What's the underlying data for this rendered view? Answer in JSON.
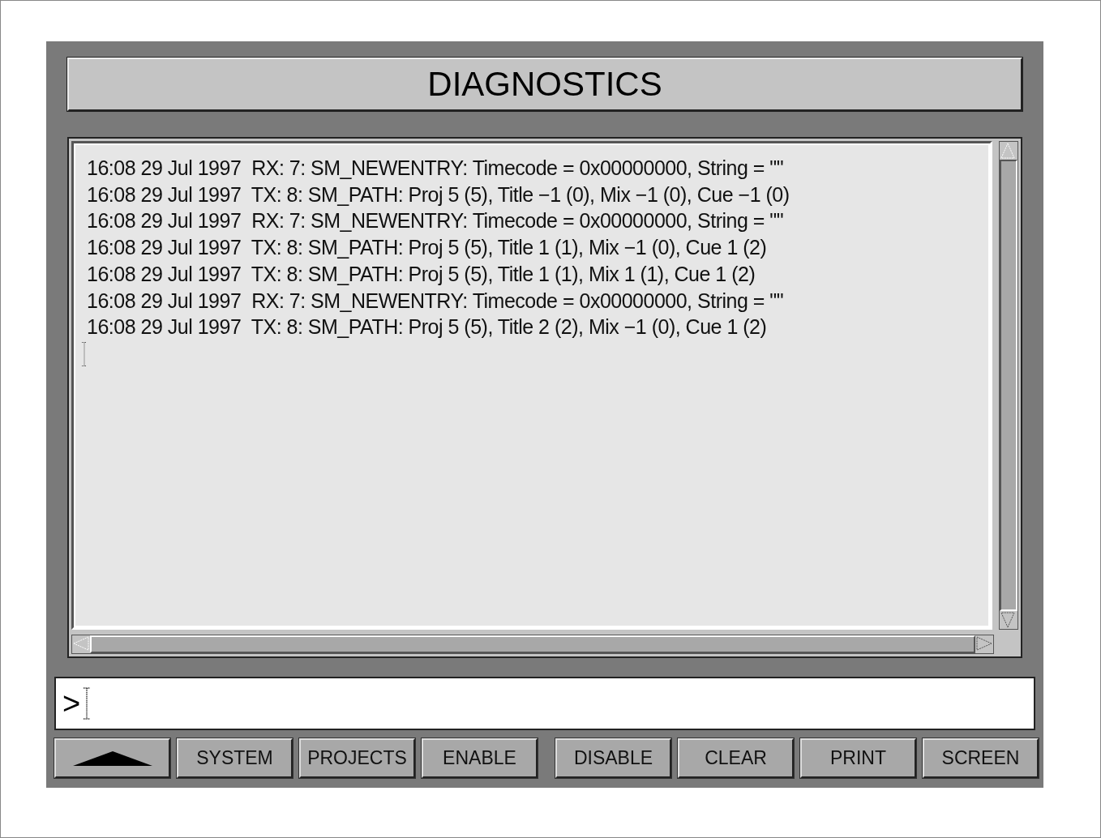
{
  "title": "DIAGNOSTICS",
  "log": [
    "16:08 29 Jul 1997  RX: 7: SM_NEWENTRY: Timecode = 0x00000000, String = \"\"",
    "16:08 29 Jul 1997  TX: 8: SM_PATH: Proj 5 (5), Title −1 (0), Mix −1 (0), Cue −1 (0)",
    "16:08 29 Jul 1997  RX: 7: SM_NEWENTRY: Timecode = 0x00000000, String = \"\"",
    "16:08 29 Jul 1997  TX: 8: SM_PATH: Proj 5 (5), Title 1 (1), Mix −1 (0), Cue 1 (2)",
    "16:08 29 Jul 1997  TX: 8: SM_PATH: Proj 5 (5), Title 1 (1), Mix 1 (1), Cue 1 (2)",
    "16:08 29 Jul 1997  RX: 7: SM_NEWENTRY: Timecode = 0x00000000, String = \"\"",
    "16:08 29 Jul 1997  TX: 8: SM_PATH: Proj 5 (5), Title 2 (2), Mix −1 (0), Cue 1 (2)"
  ],
  "prompt": ">",
  "button_groups": [
    [
      {
        "kind": "arrow"
      },
      {
        "kind": "text",
        "label": "SYSTEM"
      },
      {
        "kind": "text",
        "label": "PROJECTS"
      },
      {
        "kind": "text",
        "label": "ENABLE"
      }
    ],
    [
      {
        "kind": "text",
        "label": "DISABLE"
      },
      {
        "kind": "text",
        "label": "CLEAR"
      },
      {
        "kind": "text",
        "label": "PRINT"
      },
      {
        "kind": "text",
        "label": "SCREEN"
      }
    ]
  ]
}
